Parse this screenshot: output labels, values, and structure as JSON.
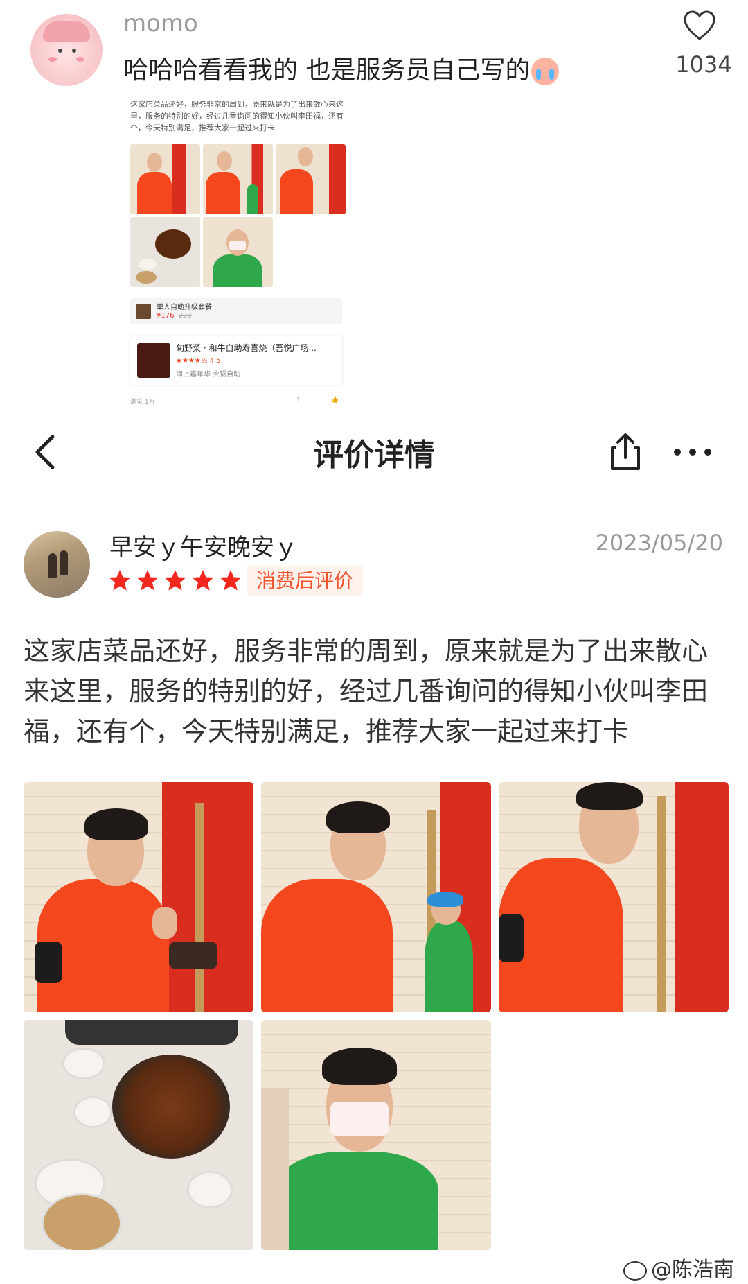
{
  "comment": {
    "username": "momo",
    "text": "哈哈哈看看我的 也是服务员自己写的",
    "emoji": "crying-laughing-emoji",
    "like_count": "1034"
  },
  "embedded_screenshot": {
    "review_text": "这家店菜品还好，服务非常的周到，原来就是为了出来散心来这里，服务的特别的好，经过几番询问的得知小伙叫李田福，还有个，今天特别满足，推荐大家一起过来打卡",
    "product_name": "单人自助升级套餐",
    "product_price": "¥176",
    "product_old_price": "228",
    "shop_name": "旬野菜 · 和牛自助寿喜烧（吾悦广场...",
    "shop_rating": "★★★★½ 4.5",
    "shop_sub": "海上嘉年华  火锅自助",
    "footer_views": "浏览 1万",
    "footer_comments": "1"
  },
  "nav": {
    "title": "评价详情",
    "back_icon": "chevron-left-icon",
    "share_icon": "share-icon",
    "more_icon": "more-dots-icon"
  },
  "review": {
    "username": "早安ｙ午安晚安ｙ",
    "date": "2023/05/20",
    "stars": 5,
    "badge": "消费后评价",
    "text": "这家店菜品还好，服务非常的周到，原来就是为了出来散心来这里，服务的特别的好，经过几番询问的得知小伙叫李田福，还有个，今天特别满足，推荐大家一起过来打卡",
    "photo_count": 5
  },
  "watermark": "@陈浩南",
  "colors": {
    "star": "#f2281e",
    "badge_text": "#f2542d",
    "badge_bg": "#fff1ec",
    "staff_shirt_red": "#f4471e",
    "staff_shirt_green": "#2ea84a"
  }
}
